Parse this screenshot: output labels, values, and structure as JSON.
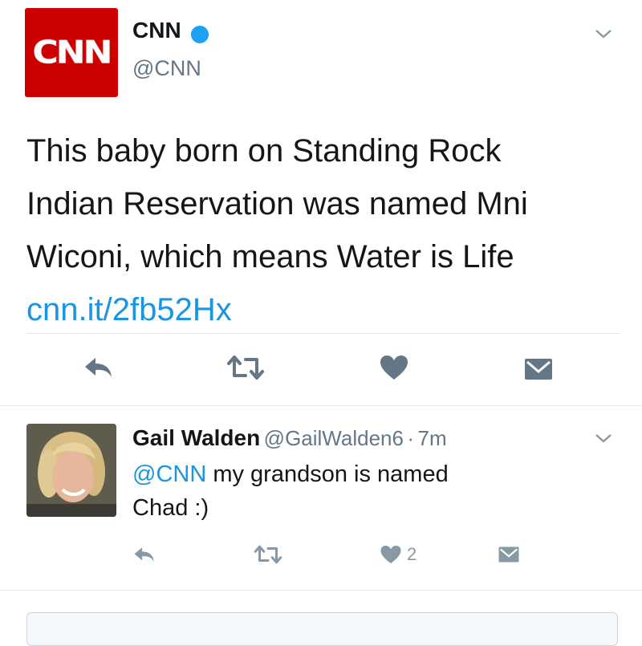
{
  "tweet": {
    "logo_text": "CNN",
    "author_name": "CNN",
    "author_handle": "@CNN",
    "text_lines": [
      "This baby born on Standing Rock",
      "Indian Reservation was named Mni",
      "Wiconi, which means Water is Life"
    ],
    "link": "cnn.it/2fb52Hx"
  },
  "reply": {
    "author_name": "Gail Walden",
    "author_handle": "@GailWalden6",
    "separator": "·",
    "time": "7m",
    "mention": "@CNN",
    "text_line1": " my grandson is named",
    "text_line2": "Chad :)",
    "like_count": "2"
  },
  "colors": {
    "brand_red": "#cc0000",
    "link_blue": "#1b95e0",
    "icon_gray": "#657786"
  },
  "icons": [
    "chevron-down-icon",
    "verified-badge-icon",
    "reply-icon",
    "retweet-icon",
    "like-icon",
    "direct-message-icon"
  ]
}
